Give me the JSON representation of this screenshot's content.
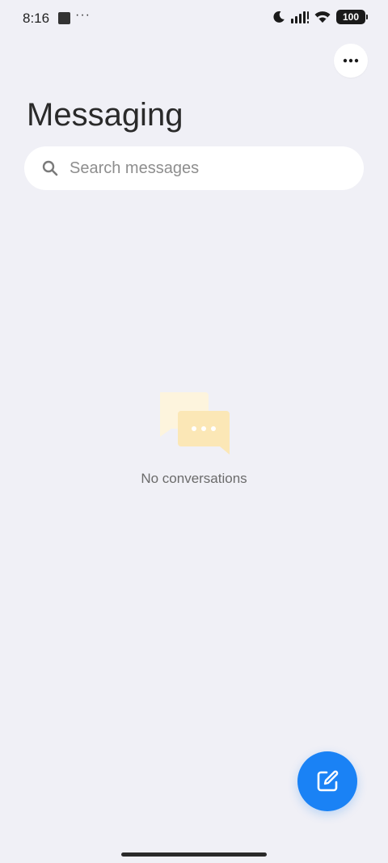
{
  "status_bar": {
    "time": "8:16",
    "overflow": "···",
    "battery": "100",
    "icons": [
      "moon-icon",
      "signal-icon",
      "wifi-icon",
      "battery-icon"
    ]
  },
  "header": {
    "title": "Messaging",
    "more_icon": "more-horizontal-icon"
  },
  "search": {
    "placeholder": "Search messages",
    "icon": "search-icon"
  },
  "empty_state": {
    "message": "No conversations",
    "icon": "chat-bubbles-icon"
  },
  "fab": {
    "icon": "compose-icon"
  },
  "colors": {
    "background": "#f0f0f6",
    "accent": "#1a82f5",
    "surface": "#ffffff",
    "bubble_back": "#fdf4dd",
    "bubble_front": "#fbe7b6"
  }
}
